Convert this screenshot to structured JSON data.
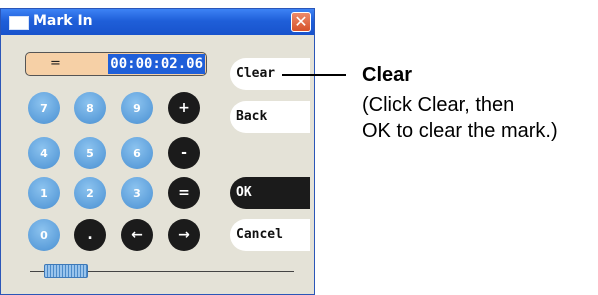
{
  "window": {
    "title": "Mark In",
    "close_label": "✕"
  },
  "display": {
    "operator": "=",
    "timecode": "00:00:02.06"
  },
  "keypad": {
    "row1": [
      "7",
      "8",
      "9",
      "+"
    ],
    "row2": [
      "4",
      "5",
      "6",
      "-"
    ],
    "row3": [
      "1",
      "2",
      "3",
      "="
    ],
    "row4": [
      "0",
      ".",
      "←",
      "→"
    ]
  },
  "buttons": {
    "clear": "Clear",
    "back": "Back",
    "ok": "OK",
    "cancel": "Cancel"
  },
  "callout": {
    "title": "Clear",
    "line1": "(Click Clear, then",
    "line2": "OK to clear the mark.)"
  },
  "colors": {
    "titlebar": "#1f5fd9",
    "display_bg": "#f6d0a6",
    "key_blue": "#5d9fdb",
    "key_black": "#1b1b1b"
  }
}
